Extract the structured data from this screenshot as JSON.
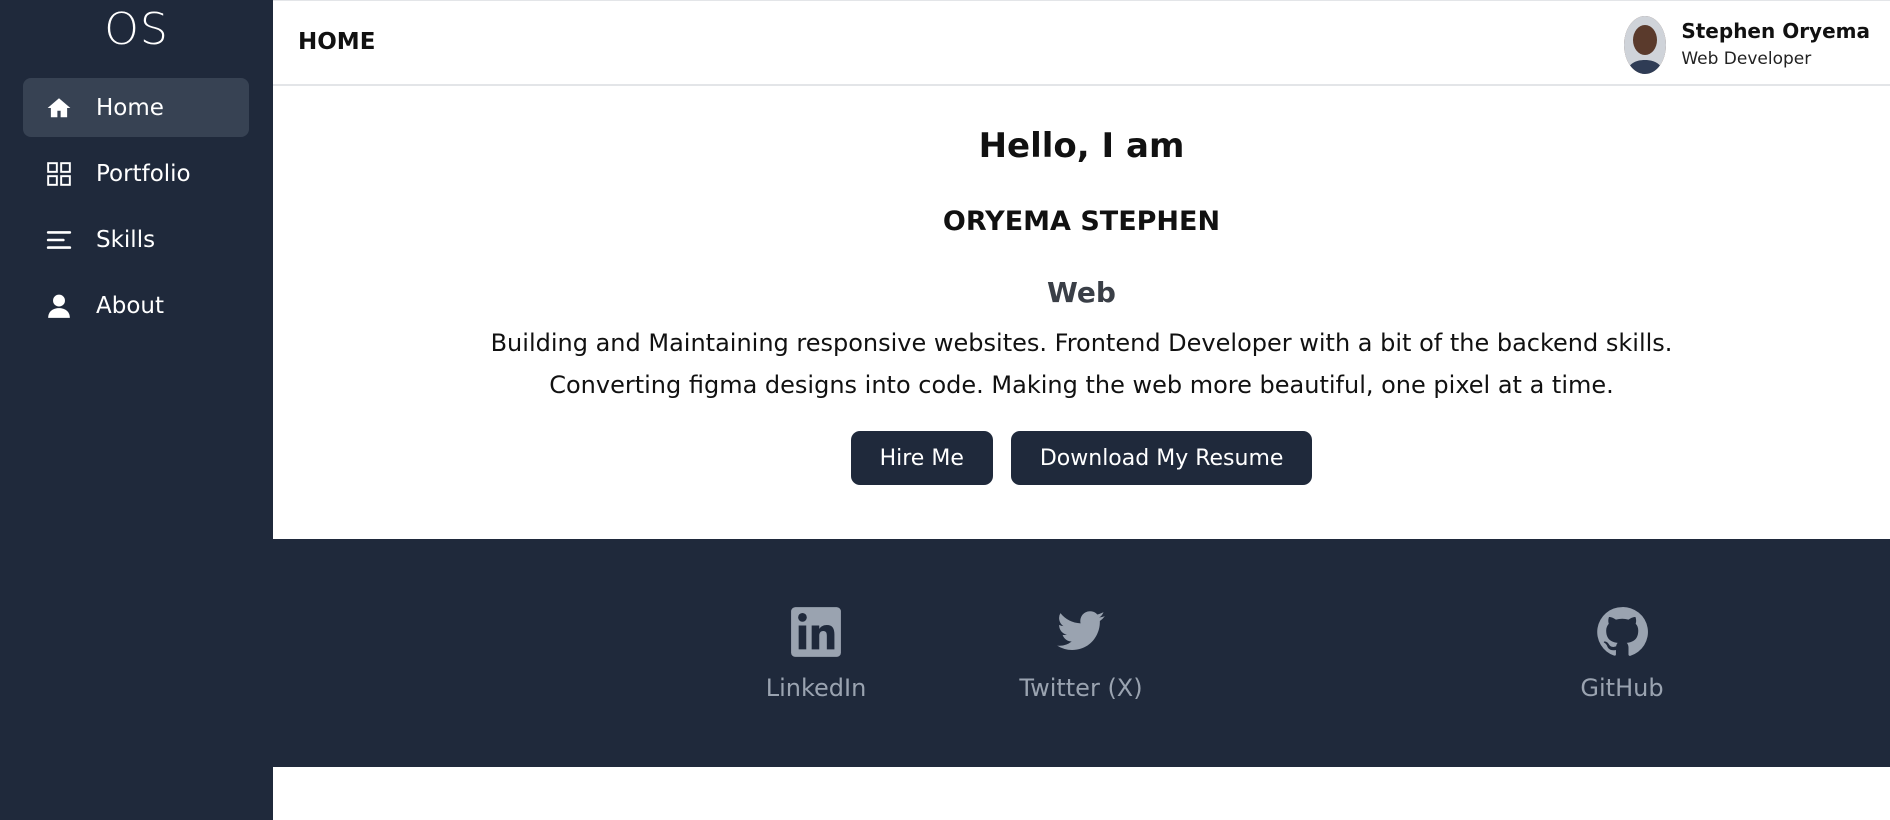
{
  "sidebar": {
    "logo": "OS",
    "items": [
      {
        "label": "Home",
        "icon": "home-icon",
        "active": true
      },
      {
        "label": "Portfolio",
        "icon": "grid-icon",
        "active": false
      },
      {
        "label": "Skills",
        "icon": "list-icon",
        "active": false
      },
      {
        "label": "About",
        "icon": "user-icon",
        "active": false
      }
    ]
  },
  "header": {
    "title": "HOME",
    "profile": {
      "name": "Stephen Oryema",
      "role": "Web Developer"
    }
  },
  "hero": {
    "greeting": "Hello, I am",
    "name": "ORYEMA STEPHEN",
    "typed_text": "Web",
    "description_line1": "Building and Maintaining responsive websites. Frontend Developer with a bit of the backend skills.",
    "description_line2": "Converting figma designs into code. Making the web more beautiful, one pixel at a time.",
    "hire_button": "Hire Me",
    "resume_button": "Download My Resume"
  },
  "social": {
    "links": [
      {
        "label": "LinkedIn",
        "icon": "linkedin-icon"
      },
      {
        "label": "Twitter (X)",
        "icon": "twitter-icon"
      },
      {
        "label": "GitHub",
        "icon": "github-icon"
      }
    ]
  },
  "colors": {
    "sidebar_bg": "#1f293b",
    "active_item_bg": "#374253",
    "button_bg": "#1f293b",
    "social_text": "#9aa3b0"
  }
}
